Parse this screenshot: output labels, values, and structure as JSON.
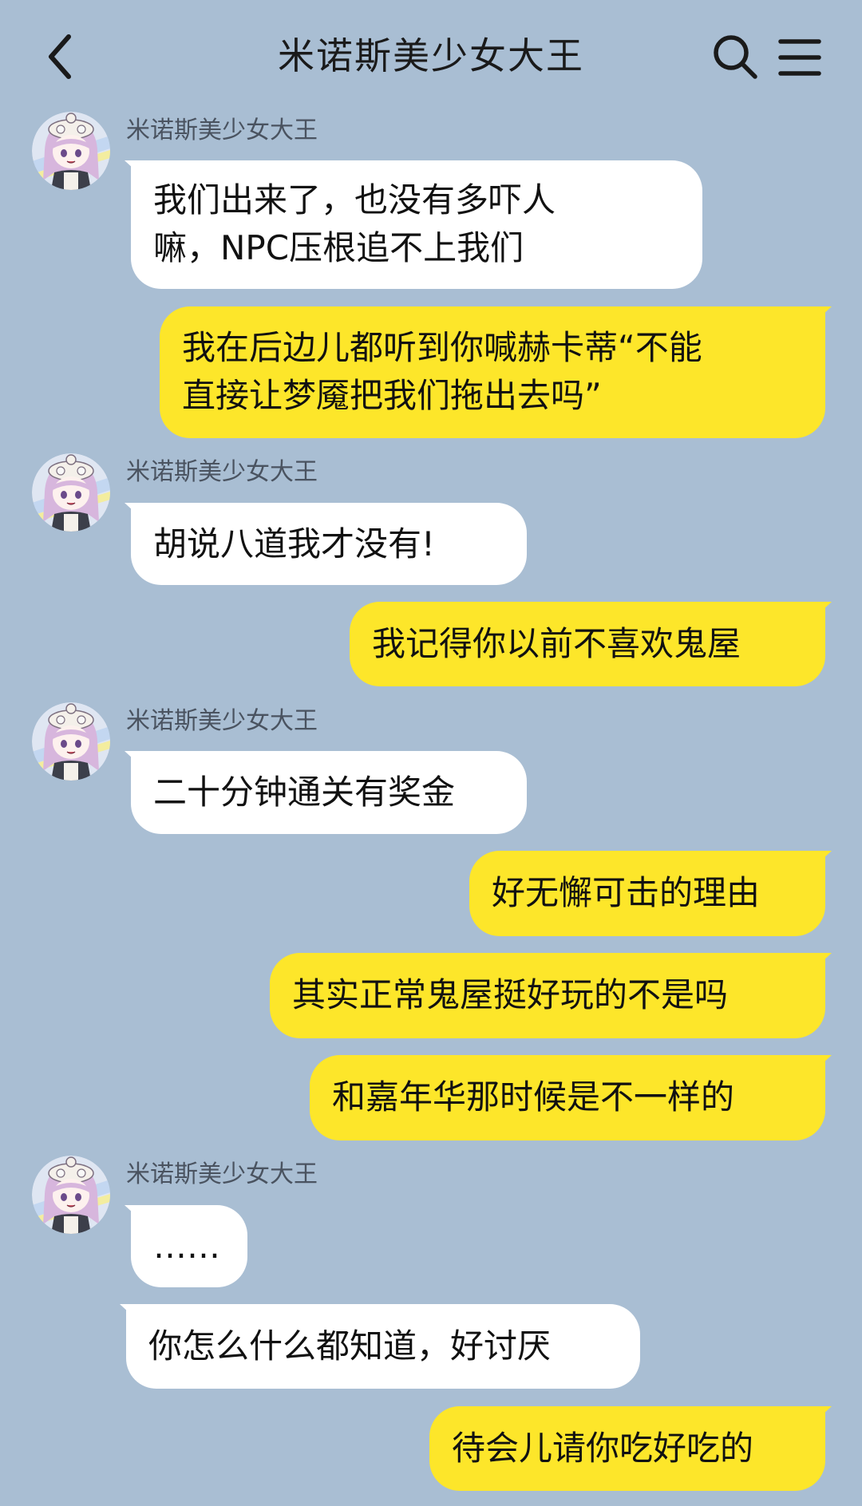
{
  "header": {
    "title": "米诺斯美少女大王",
    "back_icon": "chevron-left-icon",
    "search_icon": "search-icon",
    "menu_icon": "hamburger-menu-icon"
  },
  "contact": {
    "name": "米诺斯美少女大王",
    "avatar": "anime-girl-avatar"
  },
  "colors": {
    "background": "#a9bed3",
    "incoming_bubble": "#ffffff",
    "outgoing_bubble": "#fde62a"
  },
  "messages": [
    {
      "direction": "in",
      "sender": "米诺斯美少女大王",
      "lines": [
        "我们出来了，也没有多吓人",
        "嘛，NPC压根追不上我们"
      ]
    },
    {
      "direction": "out",
      "lines": [
        "我在后边儿都听到你喊赫卡蒂“不能",
        "直接让梦魇把我们拖出去吗”"
      ]
    },
    {
      "direction": "in",
      "sender": "米诺斯美少女大王",
      "lines": [
        "胡说八道我才没有!"
      ]
    },
    {
      "direction": "out",
      "lines": [
        "我记得你以前不喜欢鬼屋"
      ]
    },
    {
      "direction": "in",
      "sender": "米诺斯美少女大王",
      "lines": [
        "二十分钟通关有奖金"
      ]
    },
    {
      "direction": "out",
      "lines": [
        "好无懈可击的理由"
      ]
    },
    {
      "direction": "out",
      "lines": [
        "其实正常鬼屋挺好玩的不是吗"
      ]
    },
    {
      "direction": "out",
      "lines": [
        "和嘉年华那时候是不一样的"
      ]
    },
    {
      "direction": "in",
      "sender": "米诺斯美少女大王",
      "lines": [
        "……"
      ]
    },
    {
      "direction": "in",
      "lines": [
        "你怎么什么都知道，好讨厌"
      ]
    },
    {
      "direction": "out",
      "lines": [
        "待会儿请你吃好吃的"
      ]
    }
  ]
}
